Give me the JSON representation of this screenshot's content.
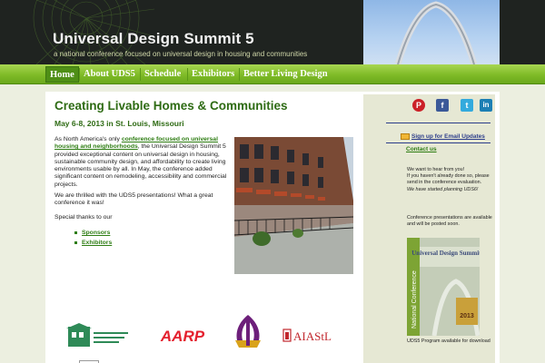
{
  "header": {
    "title": "Universal Design Summit 5",
    "tagline": "a national conference focused on universal design in housing and communities"
  },
  "nav": {
    "items": [
      {
        "label": "Home",
        "active": true
      },
      {
        "label": "About UDS5",
        "active": false
      },
      {
        "label": "Schedule",
        "active": false
      },
      {
        "label": "Exhibitors",
        "active": false
      },
      {
        "label": "Better Living Design",
        "active": false
      }
    ]
  },
  "main": {
    "title": "Creating Livable Homes & Communities",
    "subtitle": "May 6-8, 2013 in St. Louis, Missouri",
    "p1_before": "As North America's only ",
    "p1_link": "conference focused on universal housing and neighborhoods",
    "p1_after": ", the Universal Design Summit 5 provided exceptional content on universal design in housing, sustainable community design, and affordability to create living environments usable by all. In May, the conference added significant content on remodeling, accessibility and commercial projects.",
    "p2": "We are thrilled with the UDS5 presentations!  What a great conference it was!",
    "p3": "Special thanks to our",
    "links": [
      "Sponsors",
      "Exhibitors"
    ]
  },
  "logos": {
    "ucd_text": "UNIVERSAL DESIGN",
    "aarp": "AARP",
    "aia": "AIAStL",
    "slu": "SAINT LOUIS UNIVERSITY"
  },
  "sidebar": {
    "social": [
      {
        "icon": "pinterest-icon",
        "glyph": "P",
        "color": "#cb2027"
      },
      {
        "icon": "facebook-icon",
        "glyph": "f",
        "color": "#3b5998"
      },
      {
        "icon": "twitter-icon",
        "glyph": "t",
        "color": "#33aadd"
      },
      {
        "icon": "linkedin-icon",
        "glyph": "in",
        "color": "#1c7fb4"
      }
    ],
    "signup": "Sign up for Email Updates",
    "contact": "Contact us",
    "hear_line1": "We want to hear from you!",
    "hear_line2": "If you haven't already done so, please send in the conference evaluation.",
    "hear_line3": "We have started planning UDS6!",
    "presentations": "Conference presentations are available and will be posted soon.",
    "brochure_title": "Universal Design Summit 5",
    "brochure_side": "National Conference",
    "brochure_year": "2013",
    "brochure_caption": "UDS5 Program available for download"
  },
  "colors": {
    "accent_green": "#2e6b14",
    "nav_green": "#7fbb27",
    "header_dark": "#1f2320",
    "link_blue": "#2c3d8a"
  }
}
